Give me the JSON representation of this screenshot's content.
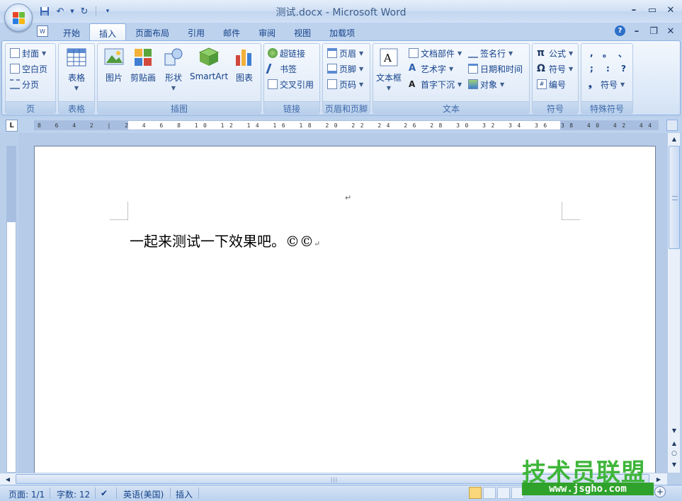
{
  "window": {
    "title": "测试.docx - Microsoft Word"
  },
  "colors": {
    "ribbon_bg": "#dde9f8",
    "text": "#15428b",
    "active_view": "#f9d77a",
    "watermark_green": "#3fb53a"
  },
  "quick_access": {
    "icons": [
      "save-icon",
      "undo-icon",
      "redo-icon",
      "customize-icon"
    ]
  },
  "tabs": [
    "开始",
    "插入",
    "页面布局",
    "引用",
    "邮件",
    "审阅",
    "视图",
    "加载项"
  ],
  "active_tab": "插入",
  "ribbon": {
    "groups": {
      "pages": {
        "label": "页",
        "items": [
          "封面",
          "空白页",
          "分页"
        ]
      },
      "tables": {
        "label": "表格",
        "items": [
          "表格"
        ]
      },
      "illustrations": {
        "label": "插图",
        "items": [
          "图片",
          "剪贴画",
          "形状",
          "SmartArt",
          "图表"
        ]
      },
      "links": {
        "label": "链接",
        "items": [
          "超链接",
          "书签",
          "交叉引用"
        ]
      },
      "header_footer": {
        "label": "页眉和页脚",
        "items": [
          "页眉",
          "页脚",
          "页码"
        ]
      },
      "text": {
        "label": "文本",
        "items": [
          "文本框",
          "文档部件",
          "艺术字",
          "首字下沉",
          "签名行",
          "日期和时间",
          "对象"
        ]
      },
      "symbols": {
        "label": "符号",
        "items": [
          "公式",
          "符号",
          "编号"
        ]
      },
      "special_symbols": {
        "label": "特殊符号",
        "chars": [
          ",",
          "。",
          "、",
          ";",
          ":",
          "?"
        ],
        "more": "符号"
      }
    }
  },
  "ruler": {
    "horizontal_labels": "8 6 4 2 | 2 4 6 8 10 12 14 16 18 20 22 24 26 28 30 32 34 36 38 40 42 44 46 48",
    "ruler_button": "L"
  },
  "document": {
    "body_text": "一起来测试一下效果吧。©©",
    "paragraph_mark": "↵"
  },
  "statusbar": {
    "page": "页面: 1/1",
    "words": "字数: 12",
    "language": "英语(美国)",
    "mode": "插入"
  },
  "watermark": {
    "title": "技术员联盟",
    "url": "www.jsgho.com"
  }
}
